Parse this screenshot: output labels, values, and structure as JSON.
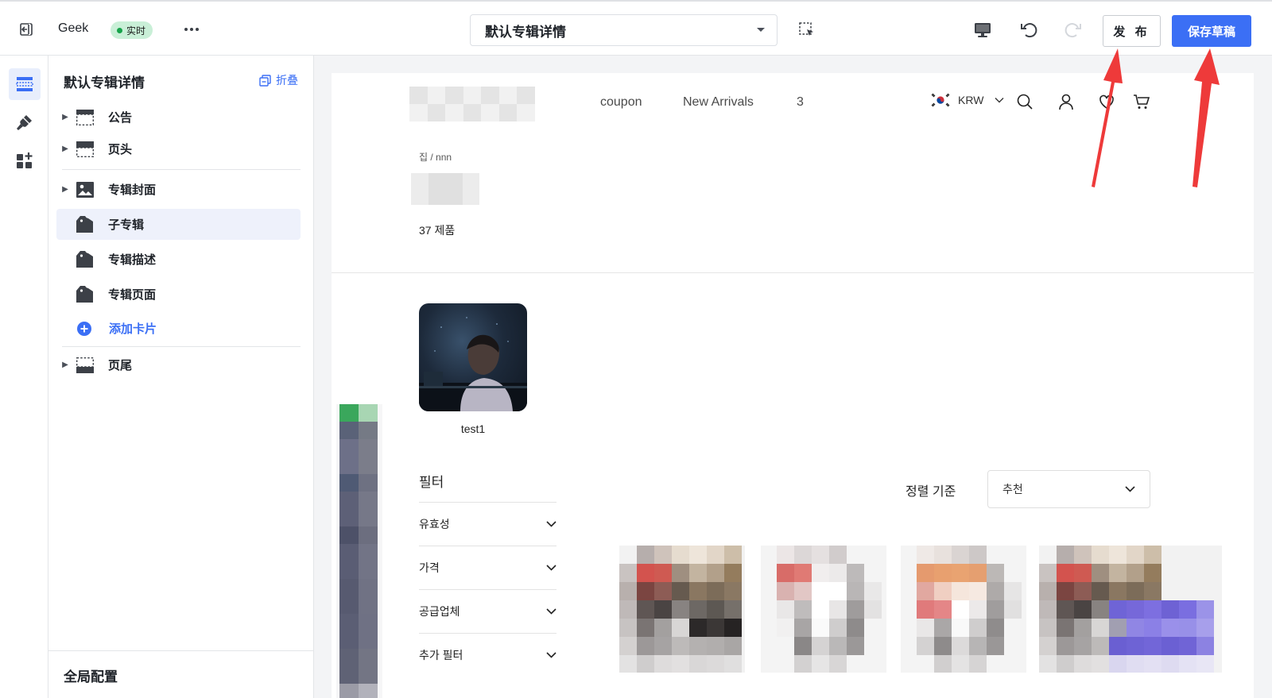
{
  "topbar": {
    "store_name": "Geek",
    "live_label": "实时",
    "page_select": "默认专辑详情",
    "publish_label": "发 布",
    "save_draft_label": "保存草稿"
  },
  "panel": {
    "title": "默认专辑详情",
    "collapse_label": "折叠",
    "items": [
      {
        "label": "公告",
        "icon": "announcement-section-icon"
      },
      {
        "label": "页头",
        "icon": "header-section-icon"
      },
      {
        "label": "专辑封面",
        "icon": "image-icon"
      },
      {
        "label": "子专辑",
        "icon": "tag-icon"
      },
      {
        "label": "专辑描述",
        "icon": "tag-icon"
      },
      {
        "label": "专辑页面",
        "icon": "tag-icon"
      },
      {
        "label": "添加卡片",
        "icon": "plus-circle-icon"
      },
      {
        "label": "页尾",
        "icon": "footer-section-icon"
      }
    ],
    "global_config_label": "全局配置"
  },
  "preview": {
    "nav": [
      "coupon",
      "New Arrivals",
      "3"
    ],
    "currency": "KRW",
    "breadcrumb": "집 / nnn",
    "product_count": "37 제품",
    "subcollection_label": "test1",
    "filter_title": "필터",
    "filters": [
      "유효성",
      "가격",
      "공급업체",
      "추가 필터"
    ],
    "sort_label": "정렬 기준",
    "sort_value": "추천"
  },
  "colors": {
    "accent": "#3b6ff5",
    "live_badge_bg": "#c9efd7",
    "annotation_arrow": "#ee3a3a"
  }
}
